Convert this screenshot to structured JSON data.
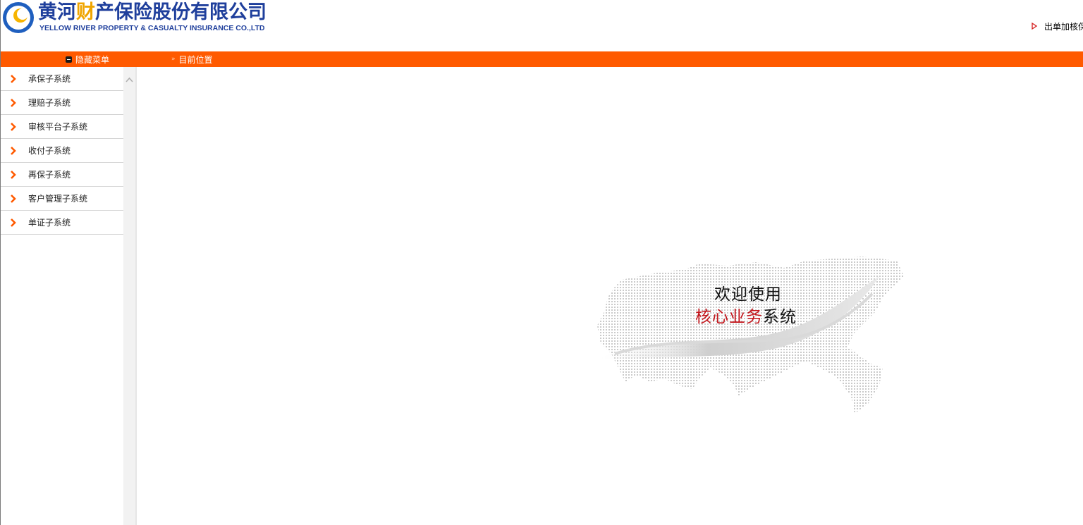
{
  "header": {
    "brand_cn_main": "黄河",
    "brand_cn_accent": "财",
    "brand_cn_rest": "产保险股份有限公司",
    "brand_en": "YELLOW RIVER PROPERTY & CASUALTY INSURANCE CO.,LTD",
    "right_link": "出单加核保"
  },
  "navbar": {
    "hide_menu": "隐藏菜单",
    "location_label": "目前位置"
  },
  "sidebar": {
    "items": [
      {
        "label": "承保子系统"
      },
      {
        "label": "理赔子系统"
      },
      {
        "label": "审核平台子系统"
      },
      {
        "label": "收付子系统"
      },
      {
        "label": "再保子系统"
      },
      {
        "label": "客户管理子系统"
      },
      {
        "label": "单证子系统"
      }
    ]
  },
  "welcome": {
    "line1": "欢迎使用",
    "line2_highlight": "核心业务",
    "line2_rest": "系统"
  },
  "colors": {
    "brand_blue": "#1f3f9c",
    "brand_orange": "#ff5a00",
    "accent_red": "#c4161c"
  }
}
